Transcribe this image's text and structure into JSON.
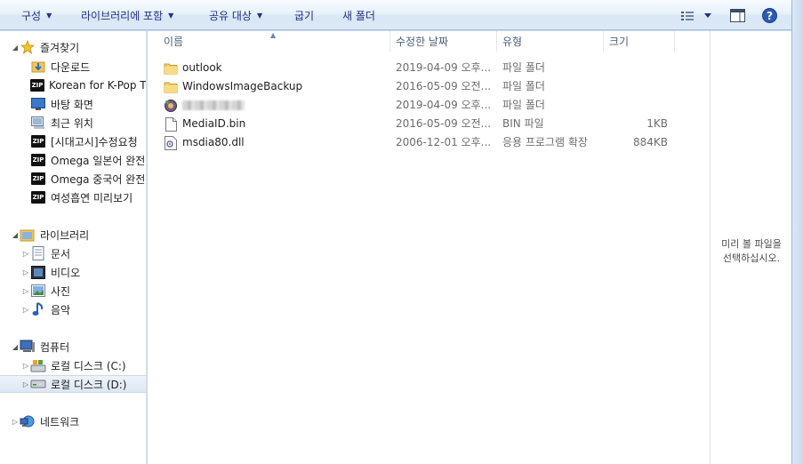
{
  "toolbar": {
    "organize": "구성",
    "include_library": "라이브러리에 포함",
    "share": "공유 대상",
    "burn": "굽기",
    "new_folder": "새 폴더"
  },
  "nav": {
    "favorites": "즐겨찾기",
    "downloads": "다운로드",
    "korean_kpop": "Korean for K-Pop Tr",
    "desktop": "바탕 화면",
    "recent": "최근 위치",
    "exam": "[시대고시]수정요청",
    "omega_jp": "Omega 일본어 완전",
    "omega_cn": "Omega 중국어 완전",
    "women": "여성흡연 미리보기",
    "libraries": "라이브러리",
    "documents": "문서",
    "videos": "비디오",
    "pictures": "사진",
    "music": "음악",
    "computer": "컴퓨터",
    "disk_c": "로컬 디스크 (C:)",
    "disk_d": "로컬 디스크 (D:)",
    "network": "네트워크"
  },
  "columns": {
    "name": "이름",
    "date": "수정한 날짜",
    "type": "유형",
    "size": "크기"
  },
  "files": [
    {
      "name": "outlook",
      "date": "2019-04-09 오후...",
      "type": "파일 폴더",
      "size": ""
    },
    {
      "name": "WindowsImageBackup",
      "date": "2016-05-09 오전...",
      "type": "파일 폴더",
      "size": ""
    },
    {
      "name": "",
      "date": "2019-04-09 오후...",
      "type": "파일 폴더",
      "size": ""
    },
    {
      "name": "MediaID.bin",
      "date": "2016-05-09 오전...",
      "type": "BIN 파일",
      "size": "1KB"
    },
    {
      "name": "msdia80.dll",
      "date": "2006-12-01 오후...",
      "type": "응용 프로그램 확장",
      "size": "884KB"
    }
  ],
  "preview": {
    "line1": "미리 볼 파일을",
    "line2": "선택하십시오."
  },
  "icons": {
    "view": "view-options-icon",
    "preview_pane": "preview-pane-icon",
    "help": "help-icon"
  }
}
